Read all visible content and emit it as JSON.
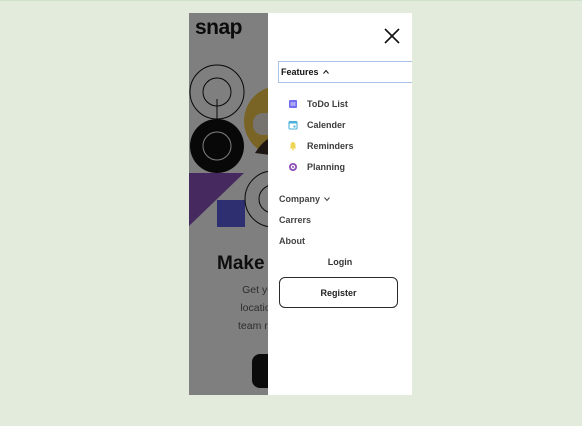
{
  "app": {
    "logo": "snap"
  },
  "hero": {
    "title": "Make",
    "text_lines": [
      "Get your tea",
      "location. Stre",
      "team rituals, a"
    ]
  },
  "menu": {
    "features_label": "Features",
    "features_items": [
      {
        "label": "ToDo List",
        "icon": "todo-list-icon",
        "color": "#726CEE"
      },
      {
        "label": "Calender",
        "icon": "calendar-icon",
        "color": "#4BB1DA"
      },
      {
        "label": "Reminders",
        "icon": "bell-icon",
        "color": "#EDD556"
      },
      {
        "label": "Planning",
        "icon": "planning-icon",
        "color": "#8E4CB6"
      }
    ],
    "company_label": "Company",
    "careers_label": "Carrers",
    "about_label": "About",
    "login_label": "Login",
    "register_label": "Register"
  }
}
